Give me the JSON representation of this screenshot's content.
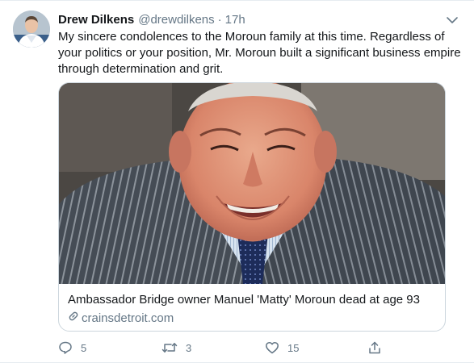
{
  "tweet": {
    "author": {
      "name": "Drew Dilkens",
      "handle": "@drewdilkens",
      "separator": "·",
      "time": "17h"
    },
    "text": "My sincere condolences to the Moroun family at this time. Regardless of your politics or your position, Mr. Moroun built a significant business empire through determination and grit.",
    "card": {
      "title": "Ambassador Bridge owner Manuel 'Matty' Moroun dead at age 93",
      "domain": "crainsdetroit.com"
    },
    "actions": {
      "reply_count": "5",
      "retweet_count": "3",
      "like_count": "15"
    }
  },
  "icons": {
    "reply": "speech-bubble-icon",
    "retweet": "retweet-arrows-icon",
    "like": "heart-outline-icon",
    "share": "share-upload-icon",
    "caret": "chevron-down-icon",
    "link": "link-icon"
  },
  "colors": {
    "text_primary": "#14171a",
    "text_secondary": "#657786",
    "border": "#ccd6dd"
  }
}
